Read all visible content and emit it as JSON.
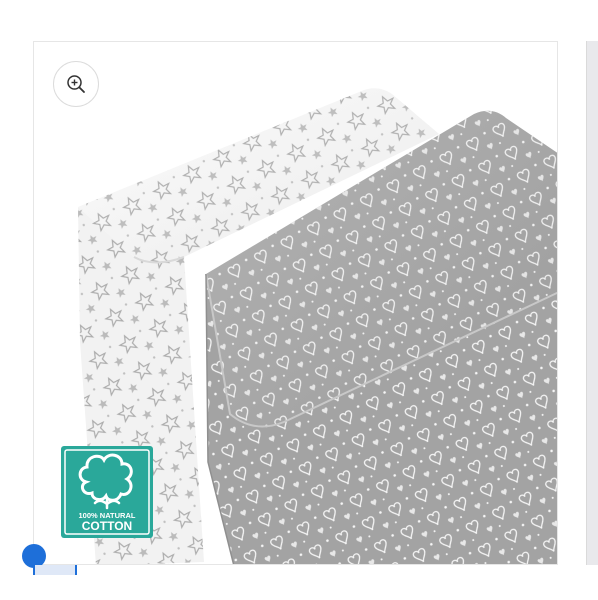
{
  "gallery": {
    "zoom_button_icon": "zoom-in-icon",
    "badge": {
      "line1": "100% NATURAL",
      "line2": "COTTON",
      "color": "#2aa89a"
    },
    "sheet_colors": {
      "white_sheet": "#f7f7f7",
      "gray_sheet": "#a9a9a9",
      "pattern_star": "#b0b0b0",
      "pattern_heart": "#ffffff"
    }
  },
  "widget": {
    "accent": "#1e6fd9"
  }
}
